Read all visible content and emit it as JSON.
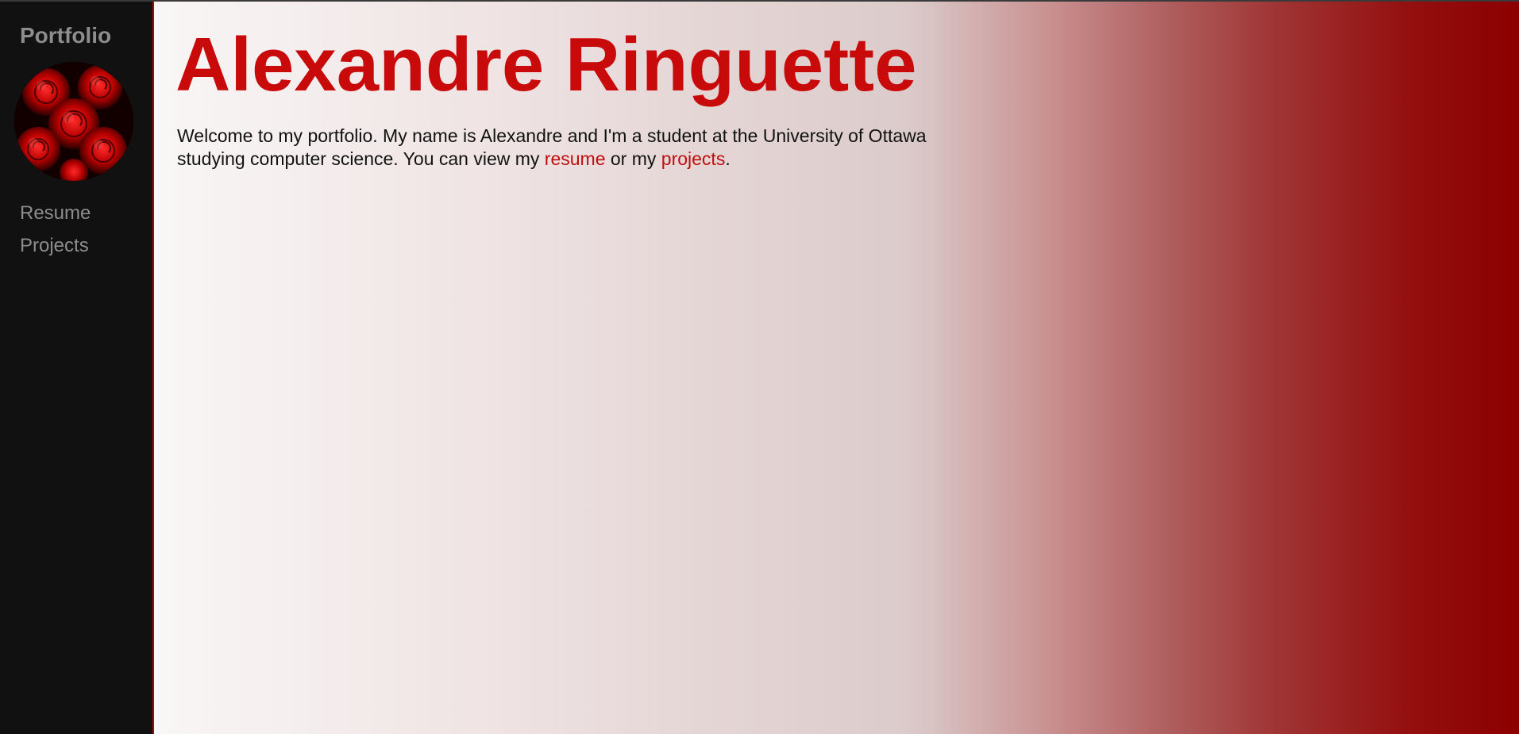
{
  "sidebar": {
    "brand": "Portfolio",
    "avatar_icon": "rose-avatar-icon",
    "nav": {
      "resume_label": "Resume",
      "projects_label": "Projects"
    }
  },
  "main": {
    "title": "Alexandre Ringuette",
    "intro": {
      "text_before": "Welcome to my portfolio. My name is Alexandre and I'm a student at the University of Ottawa studying computer science. You can view my ",
      "resume_link": "resume",
      "text_middle": " or my ",
      "projects_link": "projects",
      "text_after": "."
    }
  },
  "colors": {
    "accent": "#c80a0a",
    "sidebar_bg": "#111111",
    "sidebar_text": "#8d8d8d",
    "gradient_end": "#8c0000"
  }
}
